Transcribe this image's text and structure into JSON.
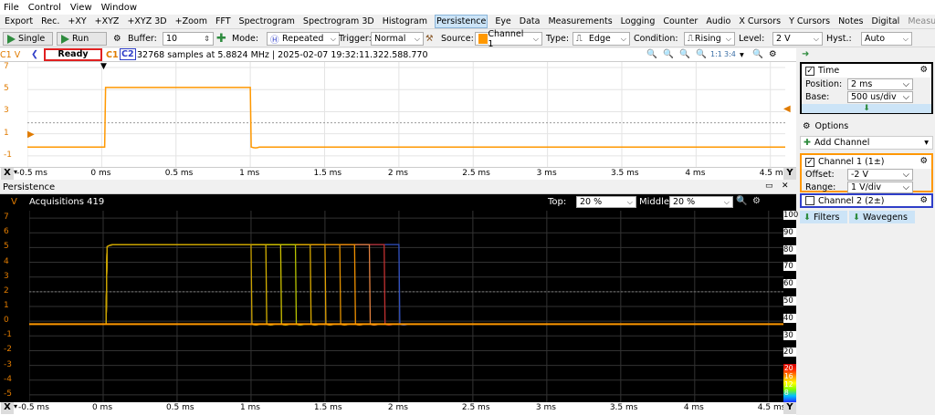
{
  "menu": [
    "File",
    "Control",
    "View",
    "Window"
  ],
  "tabs": [
    {
      "label": "Export",
      "state": "normal"
    },
    {
      "label": "Rec.",
      "state": "normal"
    },
    {
      "label": "+XY",
      "state": "normal"
    },
    {
      "label": "+XYZ",
      "state": "normal"
    },
    {
      "label": "+XYZ 3D",
      "state": "normal"
    },
    {
      "label": "+Zoom",
      "state": "normal"
    },
    {
      "label": "FFT",
      "state": "normal"
    },
    {
      "label": "Spectrogram",
      "state": "normal"
    },
    {
      "label": "Spectrogram 3D",
      "state": "normal"
    },
    {
      "label": "Histogram",
      "state": "normal"
    },
    {
      "label": "Persistence",
      "state": "active"
    },
    {
      "label": "Eye",
      "state": "normal"
    },
    {
      "label": "Data",
      "state": "normal"
    },
    {
      "label": "Measurements",
      "state": "normal"
    },
    {
      "label": "Logging",
      "state": "normal"
    },
    {
      "label": "Counter",
      "state": "normal"
    },
    {
      "label": "Audio",
      "state": "normal"
    },
    {
      "label": "X Cursors",
      "state": "normal"
    },
    {
      "label": "Y Cursors",
      "state": "normal"
    },
    {
      "label": "Notes",
      "state": "normal"
    },
    {
      "label": "Digital",
      "state": "normal"
    },
    {
      "label": "Measurements",
      "state": "disabled"
    }
  ],
  "toolbar": {
    "single": "Single",
    "run": "Run",
    "buffer_label": "Buffer:",
    "buffer_value": "10",
    "mode_label": "Mode:",
    "mode_value": "Repeated",
    "trigger_label": "Trigger:",
    "trigger_value": "Normal",
    "source_label": "Source:",
    "source_value": "Channel 1",
    "type_label": "Type:",
    "type_value": "Edge",
    "condition_label": "Condition:",
    "condition_value": "Rising",
    "level_label": "Level:",
    "level_value": "2 V",
    "hyst_label": "Hyst.:",
    "hyst_value": "Auto"
  },
  "top_plot": {
    "c1v": "C1 V",
    "status": "Ready",
    "c1": "C1",
    "c2": "C2",
    "info": "32768 samples at 5.8824 MHz  | 2025-02-07 19:32:11.322.588.770",
    "yticks": [
      "7",
      "5",
      "3",
      "1",
      "-1"
    ],
    "xticks": [
      "-0.5 ms",
      "0 ms",
      "0.5 ms",
      "1 ms",
      "1.5 ms",
      "2 ms",
      "2.5 ms",
      "3 ms",
      "3.5 ms",
      "4 ms",
      "4.5 ms"
    ],
    "x_btn": "X",
    "y_btn": "Y"
  },
  "persistence": {
    "title": "Persistence",
    "v": "V",
    "acq": "Acquisitions 419",
    "top_label": "Top:",
    "top_value": "20 %",
    "middle_label": "Middle:",
    "middle_value": "20 %",
    "yticks": [
      "7",
      "6",
      "5",
      "4",
      "3",
      "2",
      "1",
      "0",
      "-1",
      "-2",
      "-3",
      "-4",
      "-5"
    ],
    "rticks": [
      "100",
      "90",
      "80",
      "70",
      "60",
      "50",
      "40",
      "30",
      "20",
      "10",
      "0"
    ],
    "colorbar_labels": [
      "20",
      "16",
      "12",
      "8"
    ],
    "xticks": [
      "-0.5 ms",
      "0 ms",
      "0.5 ms",
      "1 ms",
      "1.5 ms",
      "2 ms",
      "2.5 ms",
      "3 ms",
      "3.5 ms",
      "4 ms",
      "4.5 ms"
    ],
    "x_btn": "X",
    "y_btn": "Y"
  },
  "traces": {
    "high": 5.2,
    "low": -0.2,
    "rise_ms": 0.02,
    "fall_ms": [
      1.0,
      1.1,
      1.2,
      1.3,
      1.4,
      1.5,
      1.6,
      1.7,
      1.8,
      1.9,
      2.0
    ],
    "fall_colors": [
      "#c8a000",
      "#d4b000",
      "#ccc000",
      "#b8c400",
      "#d8a800",
      "#e0a000",
      "#e09000",
      "#f09000",
      "#e08040",
      "#c03030",
      "#3050c0"
    ]
  },
  "colors": {
    "trace": "#ff9800",
    "c1": "#e07b00",
    "c2": "#2f3ec8",
    "ready_border": "#e02020",
    "time_box": "#000000",
    "ch1_box": "#ff9800",
    "ch2_box": "#2f3ec8",
    "persistence_bg": "#000000"
  },
  "right": {
    "time_title": "Time",
    "position_label": "Position:",
    "position_value": "2 ms",
    "base_label": "Base:",
    "base_value": "500 us/div",
    "options": "Options",
    "add_channel": "Add Channel",
    "ch1_title": "Channel 1 (1±)",
    "offset_label": "Offset:",
    "offset_value": "-2 V",
    "range_label": "Range:",
    "range_value": "1 V/div",
    "ch2_title": "Channel 2 (2±)",
    "filters": "Filters",
    "wavegens": "Wavegens"
  }
}
